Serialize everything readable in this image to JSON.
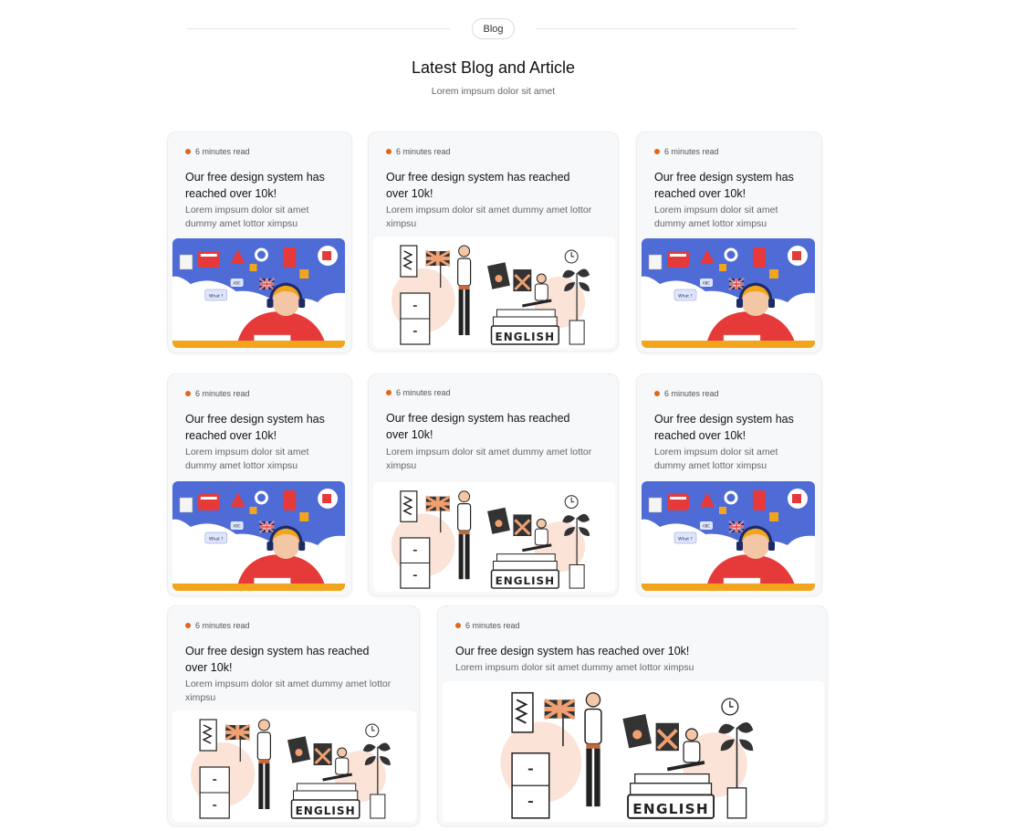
{
  "section": {
    "badge": "Blog",
    "title": "Latest Blog and Article",
    "subtitle": "Lorem impsum dolor sit amet"
  },
  "cards": [
    {
      "read_time": "6 minutes read",
      "title": "Our free design system has reached over 10k!",
      "description": "Lorem impsum dolor sit amet dummy amet lottor ximpsu",
      "illustration": "student-headphones-illustration"
    },
    {
      "read_time": "6 minutes read",
      "title": "Our free design system has reached over 10k!",
      "description": "Lorem impsum dolor sit amet dummy amet lottor ximpsu",
      "illustration": "english-learning-illustration"
    },
    {
      "read_time": "6 minutes read",
      "title": "Our free design system has reached over 10k!",
      "description": "Lorem impsum dolor sit amet dummy amet lottor ximpsu",
      "illustration": "student-headphones-illustration"
    },
    {
      "read_time": "6 minutes read",
      "title": "Our free design system has reached over 10k!",
      "description": "Lorem impsum dolor sit amet dummy amet lottor ximpsu",
      "illustration": "student-headphones-illustration"
    },
    {
      "read_time": "6 minutes read",
      "title": "Our free design system has reached over 10k!",
      "description": "Lorem impsum dolor sit amet dummy amet lottor ximpsu",
      "illustration": "english-learning-illustration"
    },
    {
      "read_time": "6 minutes read",
      "title": "Our free design system has reached over 10k!",
      "description": "Lorem impsum dolor sit amet dummy amet lottor ximpsu",
      "illustration": "student-headphones-illustration"
    },
    {
      "read_time": "6 minutes read",
      "title": "Our free design system has reached over 10k!",
      "description": "Lorem impsum dolor sit amet dummy amet lottor ximpsu",
      "illustration": "english-learning-illustration"
    },
    {
      "read_time": "6 minutes read",
      "title": "Our free design system has reached over 10k!",
      "description": "Lorem impsum dolor sit amet dummy amet lottor ximpsu",
      "illustration": "english-learning-illustration"
    }
  ],
  "illustration_text": {
    "english_sign": "ENGLISH",
    "bubble_what": "What ?",
    "bubble_abc": "ABC"
  },
  "colors": {
    "accent_dot": "#e2661a",
    "card_bg": "#f7f8fa",
    "student_bg_blue": "#4f6bd6",
    "student_shirt_red": "#e63a3a",
    "desk_yellow": "#f2a51a",
    "peach_circle": "#fbe3d8"
  }
}
